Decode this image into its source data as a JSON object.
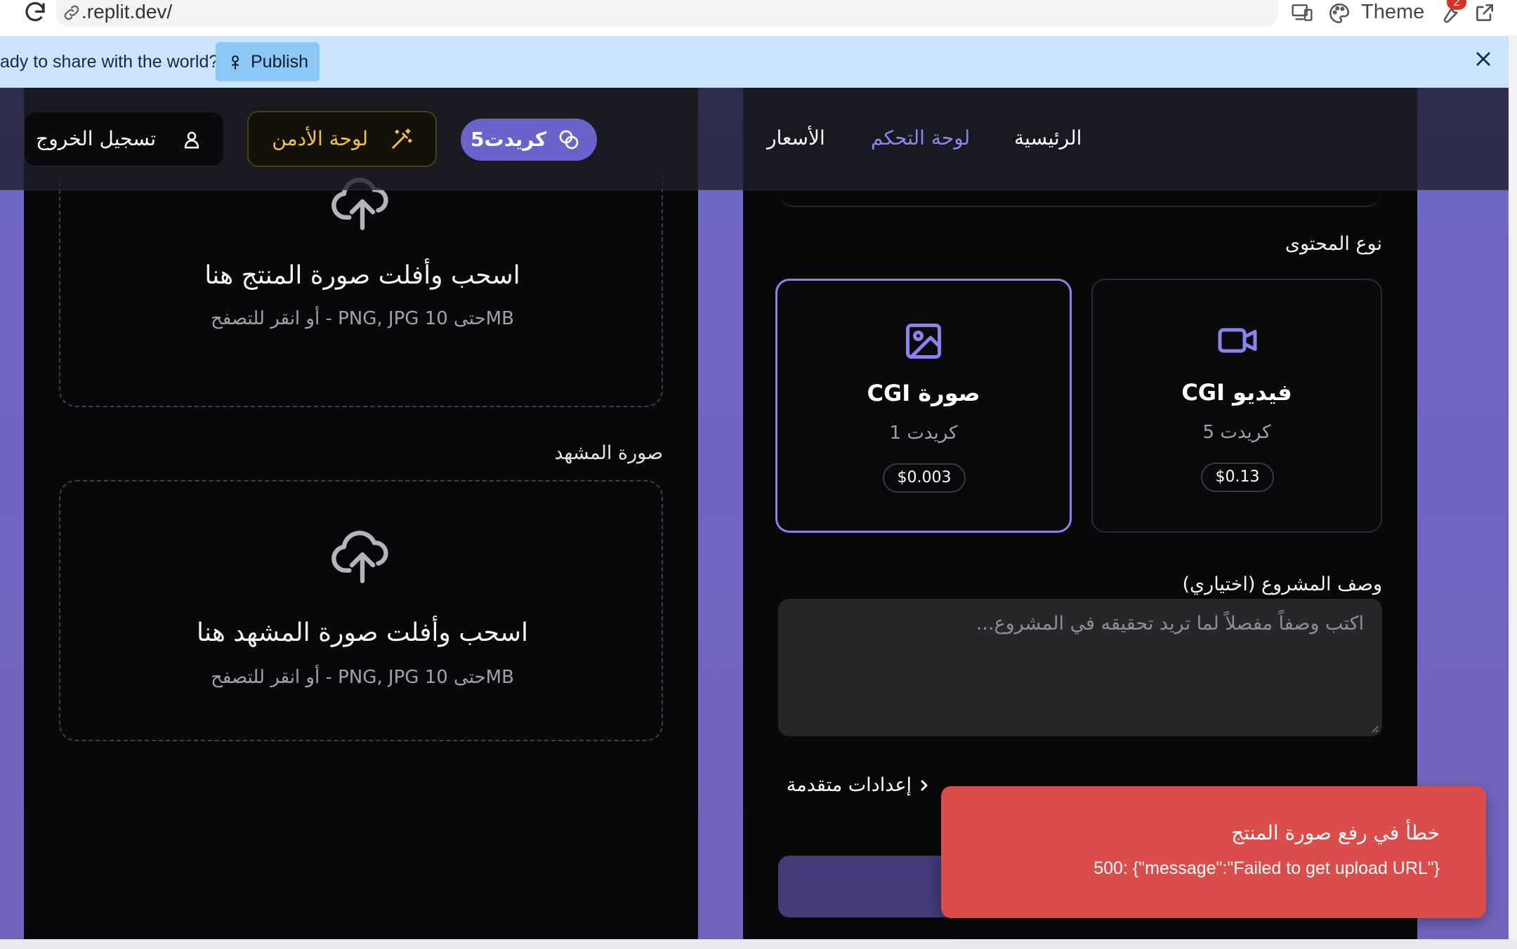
{
  "browser": {
    "url": ".replit.dev/",
    "theme_label": "Theme",
    "tools_badge": "2"
  },
  "banner": {
    "text": "ady to share with the world?",
    "publish_label": "Publish"
  },
  "nav": {
    "logout_label": "تسجيل الخروج",
    "admin_label": "لوحة الأدمن",
    "credits_label": "5كريدت",
    "links": [
      "الأسعار",
      "لوحة التحكم",
      "الرئيسية"
    ]
  },
  "left_panel": {
    "product_upload": {
      "title": "اسحب وأفلت صورة المنتج هنا",
      "subtitle": "أو انقر للتصفح - PNG, JPG حتى 10MB"
    },
    "scene_label": "صورة المشهد",
    "scene_upload": {
      "title": "اسحب وأفلت صورة المشهد هنا",
      "subtitle": "أو انقر للتصفح - PNG, JPG حتى 10MB"
    }
  },
  "right_panel": {
    "content_type_label": "نوع المحتوى",
    "cards": [
      {
        "title": "CGI صورة",
        "credit": "1 كريدت",
        "price": "$0.003",
        "icon": "image-icon",
        "selected": true
      },
      {
        "title": "CGI فيديو",
        "credit": "5 كريدت",
        "price": "$0.13",
        "icon": "video-icon",
        "selected": false
      }
    ],
    "description_label": "وصف المشروع (اختياري)",
    "description_placeholder": "اكتب وصفاً مفصلاً لما تريد تحقيقه في المشروع...",
    "advanced_label": "إعدادات متقدمة"
  },
  "toast": {
    "title": "خطأ في رفع صورة المنتج",
    "message": "500: {\"message\":\"Failed to get upload URL\"}"
  },
  "colors": {
    "accent": "#8b82ee",
    "background_purple": "#6f68c6",
    "panel": "#09090b",
    "admin_gold": "#f2c441",
    "toast_red": "#dc4c4a",
    "banner_blue": "#c9e4fb"
  }
}
